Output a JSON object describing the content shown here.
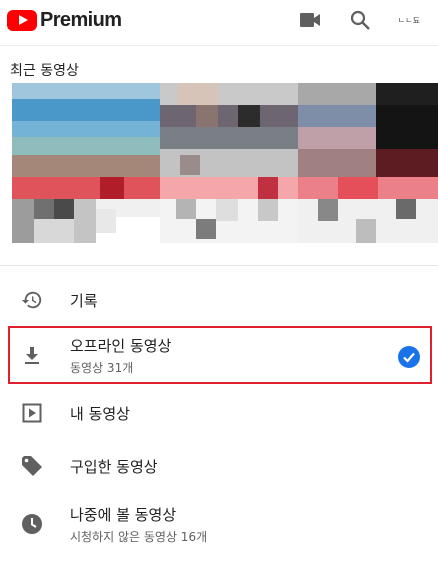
{
  "header": {
    "logo_text": "Premium",
    "account_label": "ㄴㄴ됴",
    "icons": [
      "youtube-logo-icon",
      "camera-icon",
      "search-icon"
    ]
  },
  "recent": {
    "title": "최근 동영상"
  },
  "library": {
    "history": {
      "label": "기록"
    },
    "offline": {
      "label": "오프라인 동영상",
      "sub": "동영상 31개",
      "selected": true
    },
    "my_videos": {
      "label": "내 동영상"
    },
    "purchased": {
      "label": "구입한 동영상"
    },
    "watch_later": {
      "label": "나중에 볼 동영상",
      "sub": "시청하지 않은 동영상 16개"
    }
  },
  "colors": {
    "brand_red": "#ff0000",
    "highlight_border": "#e0202e",
    "check_blue": "#1a73e8"
  }
}
